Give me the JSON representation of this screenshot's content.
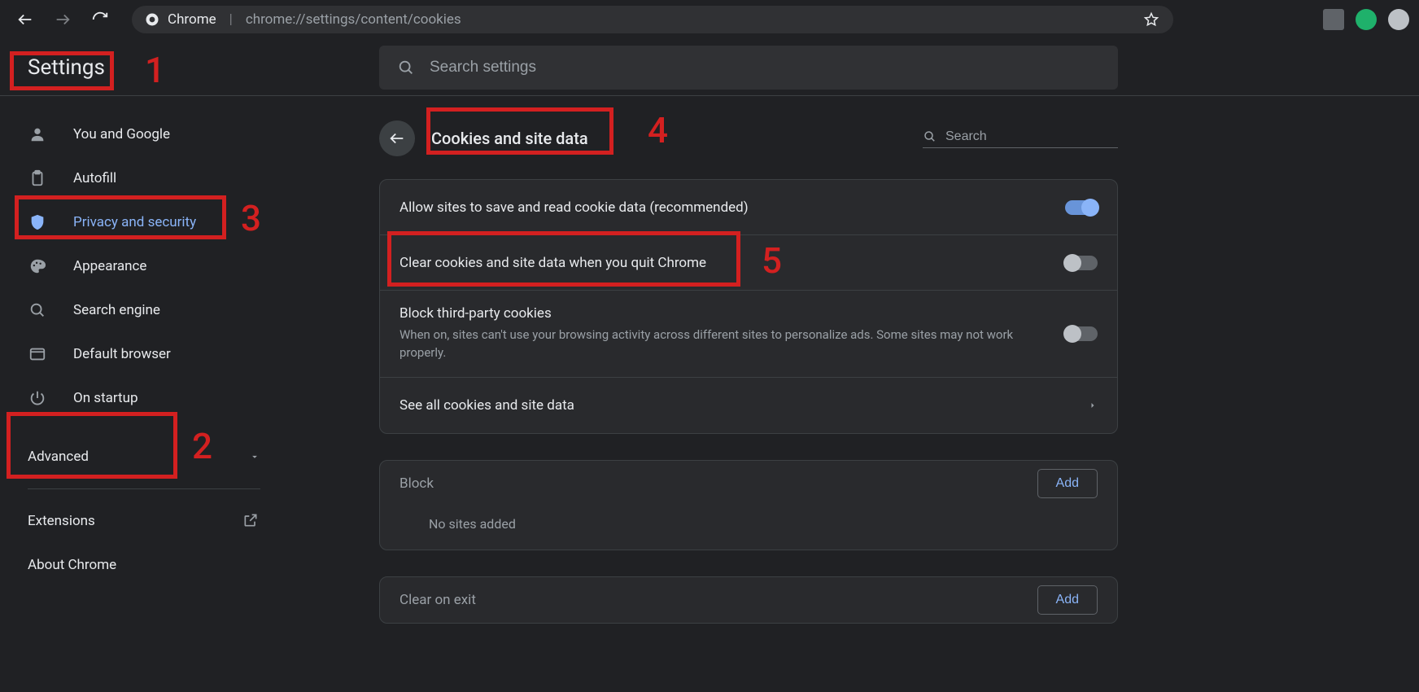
{
  "addr": {
    "label": "Chrome",
    "path": "chrome://settings/content/cookies"
  },
  "header": {
    "settings": "Settings",
    "search_ph": "Search settings"
  },
  "sidebar": {
    "items": [
      {
        "label": "You and Google"
      },
      {
        "label": "Autofill"
      },
      {
        "label": "Privacy and security"
      },
      {
        "label": "Appearance"
      },
      {
        "label": "Search engine"
      },
      {
        "label": "Default browser"
      },
      {
        "label": "On startup"
      }
    ],
    "advanced": "Advanced",
    "extensions": "Extensions",
    "about": "About Chrome"
  },
  "page": {
    "title": "Cookies and site data",
    "search_ph": "Search",
    "rows": {
      "allow": "Allow sites to save and read cookie data (recommended)",
      "clear": "Clear cookies and site data when you quit Chrome",
      "block_title": "Block third-party cookies",
      "block_sub": "When on, sites can't use your browsing activity across different sites to personalize ads. Some sites may not work properly.",
      "see_all": "See all cookies and site data"
    },
    "block_section": {
      "title": "Block",
      "empty": "No sites added",
      "add": "Add"
    },
    "clear_section": {
      "title": "Clear on exit",
      "add": "Add"
    }
  },
  "ann": {
    "1": "1",
    "2": "2",
    "3": "3",
    "4": "4",
    "5": "5"
  }
}
